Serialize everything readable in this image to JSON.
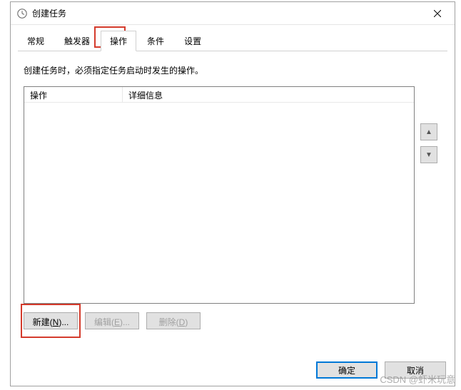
{
  "title": "创建任务",
  "tabs": {
    "general": "常规",
    "triggers": "触发器",
    "actions": "操作",
    "conditions": "条件",
    "settings": "设置"
  },
  "description": "创建任务时，必须指定任务启动时发生的操作。",
  "columns": {
    "action": "操作",
    "detail": "详细信息"
  },
  "buttons": {
    "new": "新建(N)...",
    "new_prefix": "新建(",
    "new_key": "N",
    "new_suffix": ")...",
    "edit": "编辑(E)...",
    "edit_prefix": "编辑(",
    "edit_key": "E",
    "edit_suffix": ")...",
    "delete": "删除(D)",
    "delete_prefix": "删除(",
    "delete_key": "D",
    "delete_suffix": ")",
    "ok": "确定",
    "cancel": "取消"
  },
  "watermark": "CSDN @虾米玩意"
}
